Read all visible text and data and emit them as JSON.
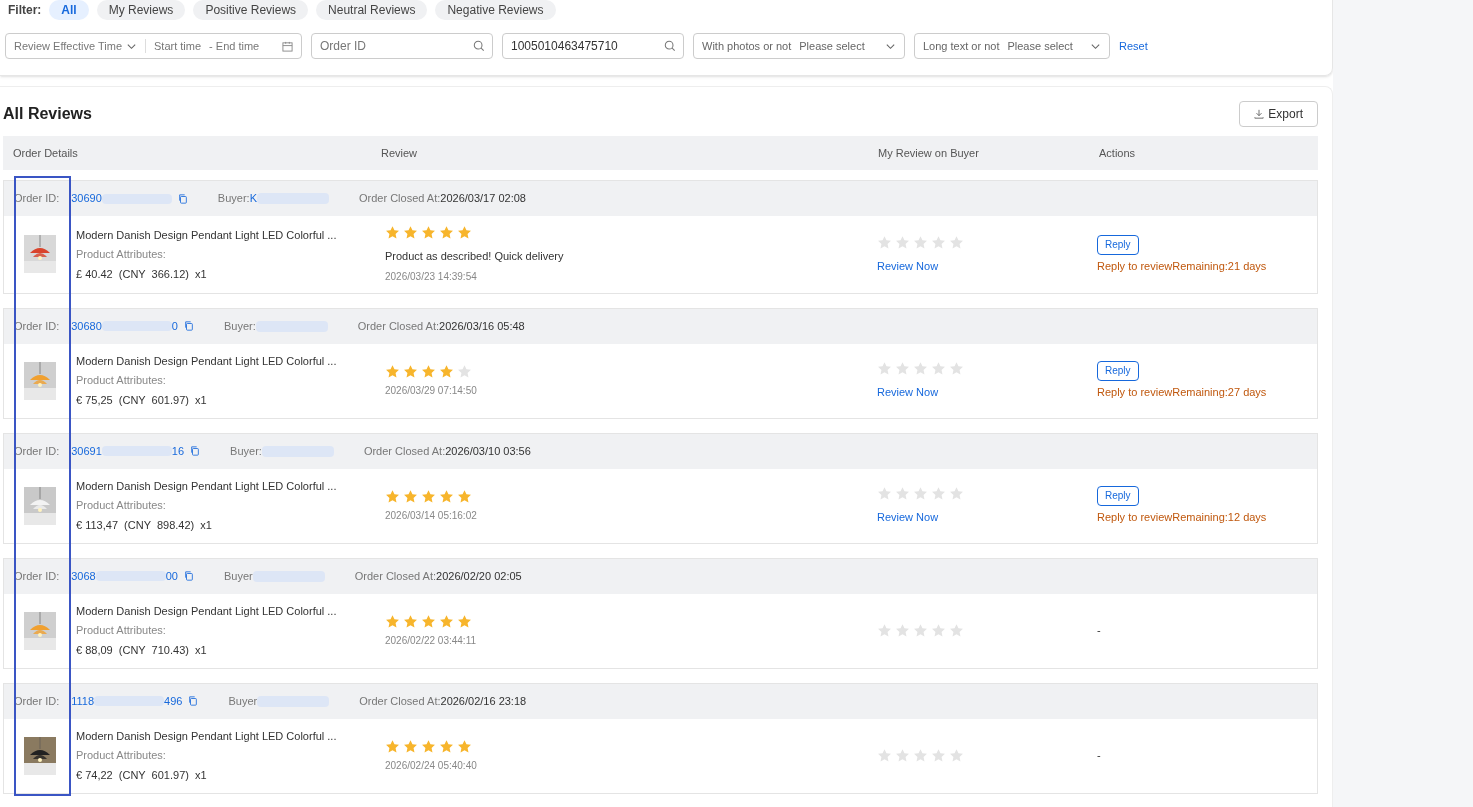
{
  "filter": {
    "label": "Filter:",
    "options": [
      {
        "label": "All",
        "selected": true
      },
      {
        "label": "My Reviews",
        "selected": false
      },
      {
        "label": "Positive Reviews",
        "selected": false
      },
      {
        "label": "Neutral Reviews",
        "selected": false
      },
      {
        "label": "Negative Reviews",
        "selected": false
      }
    ]
  },
  "search": {
    "time_label": "Review Effective Time",
    "start_placeholder": "Start time",
    "end_placeholder": "- End time",
    "order_placeholder": "Order ID",
    "product_value": "1005010463475710",
    "photos_label": "With photos or not",
    "photos_placeholder": "Please select",
    "long_label": "Long text or not",
    "long_placeholder": "Please select",
    "reset": "Reset"
  },
  "title": "All Reviews",
  "export": "Export",
  "columns": [
    "Order Details",
    "Review",
    "My Review on Buyer",
    "Actions"
  ],
  "orders": [
    {
      "order_label": "Order ID:",
      "id_start": "30690",
      "buyer_label": "Buyer:",
      "buyer": "K",
      "closed_label": "Order Closed At:",
      "closed": "2026/03/17 02:08",
      "product": "Modern Danish Design Pendant Light LED Colorful ...",
      "attributes": "Product Attributes:",
      "price": "£ 40.42  (CNY  366.12)  x1",
      "stars": 5,
      "review_text": "Product as described! Quick delivery",
      "review_time": "2026/03/23 14:39:54",
      "review_now": "Review Now",
      "action": {
        "kind": "reply",
        "button": "Reply",
        "note": "Reply to reviewRemaining:21 days"
      }
    },
    {
      "order_label": "Order ID:",
      "id_start": "30680",
      "id_end": "0",
      "buyer_label": "Buyer:",
      "closed_label": "Order Closed At:",
      "closed": "2026/03/16 05:48",
      "product": "Modern Danish Design Pendant Light LED Colorful ...",
      "attributes": "Product Attributes:",
      "price": "€ 75,25  (CNY  601.97)  x1",
      "stars": 4,
      "review_time": "2026/03/29 07:14:50",
      "review_now": "Review Now",
      "action": {
        "kind": "reply",
        "button": "Reply",
        "note": "Reply to reviewRemaining:27 days"
      }
    },
    {
      "order_label": "Order ID:",
      "id_start": "30691",
      "id_end": "16",
      "buyer_label": "Buyer:",
      "closed_label": "Order Closed At:",
      "closed": "2026/03/10 03:56",
      "product": "Modern Danish Design Pendant Light LED Colorful ...",
      "attributes": "Product Attributes:",
      "price": "€ 113,47  (CNY  898.42)  x1",
      "stars": 5,
      "review_time": "2026/03/14 05:16:02",
      "review_now": "Review Now",
      "action": {
        "kind": "reply",
        "button": "Reply",
        "note": "Reply to reviewRemaining:12 days"
      }
    },
    {
      "order_label": "Order ID:",
      "id_start": "3068",
      "id_end": "00",
      "buyer_label": "Buyer",
      "closed_label": "Order Closed At:",
      "closed": "2026/02/20 02:05",
      "product": "Modern Danish Design Pendant Light LED Colorful ...",
      "attributes": "Product Attributes:",
      "price": "€ 88,09  (CNY  710.43)  x1",
      "stars": 5,
      "review_time": "2026/02/22 03:44:11",
      "action": {
        "kind": "none",
        "text": "-"
      }
    },
    {
      "order_label": "Order ID:",
      "id_start": "1118",
      "id_end": "496",
      "buyer_label": "Buyer",
      "closed_label": "Order Closed At:",
      "closed": "2026/02/16 23:18",
      "product": "Modern Danish Design Pendant Light LED Colorful ...",
      "attributes": "Product Attributes:",
      "price": "€ 74,22  (CNY  601.97)  x1",
      "stars": 5,
      "review_time": "2026/02/24 05:40:40",
      "action": {
        "kind": "none",
        "text": "-"
      }
    }
  ]
}
